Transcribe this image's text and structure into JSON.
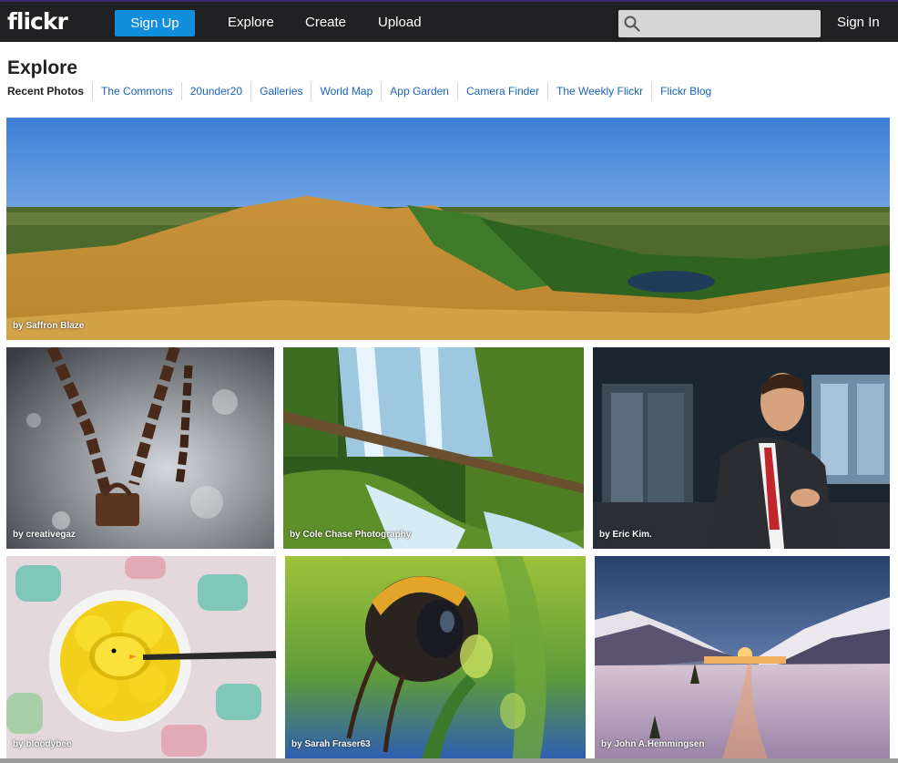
{
  "header": {
    "logo": "flickr",
    "signup_label": "Sign Up",
    "nav": [
      "Explore",
      "Create",
      "Upload"
    ],
    "search_placeholder": "",
    "signin_label": "Sign In"
  },
  "page": {
    "title": "Explore",
    "subnav": [
      "Recent Photos",
      "The Commons",
      "20under20",
      "Galleries",
      "World Map",
      "App Garden",
      "Camera Finder",
      "The Weekly Flickr",
      "Flickr Blog"
    ]
  },
  "photos": [
    {
      "credit": "by Saffron Blaze",
      "subject": "hill-panorama"
    },
    {
      "credit": "by creativegaz",
      "subject": "rusty-chain-lock"
    },
    {
      "credit": "by Cole Chase Photography",
      "subject": "waterfall"
    },
    {
      "credit": "by Eric Kim.",
      "subject": "man-in-suit"
    },
    {
      "credit": "by bloodybee",
      "subject": "yellow-chicks-cup"
    },
    {
      "credit": "by Sarah Fraser63",
      "subject": "bumblebee"
    },
    {
      "credit": "by John A.Hemmingsen",
      "subject": "snow-sunset"
    }
  ],
  "colors": {
    "topbar": "#212124",
    "signup": "#128fdc",
    "link": "#1a63bb"
  }
}
